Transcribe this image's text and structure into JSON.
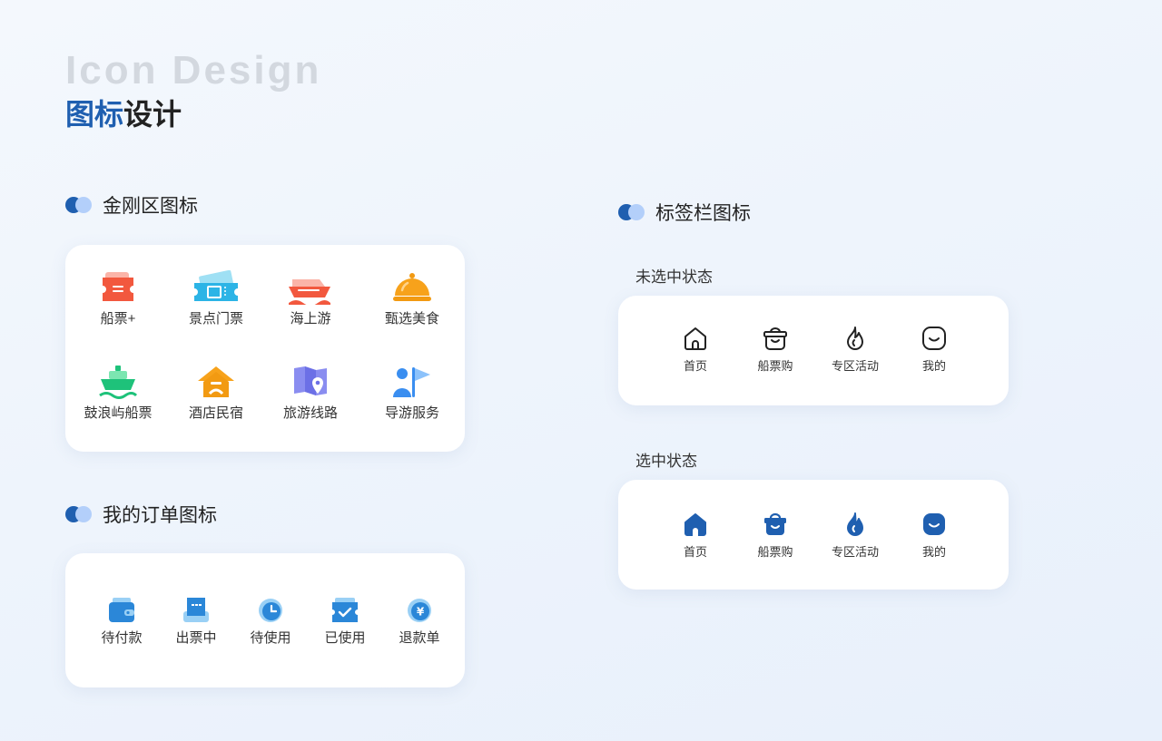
{
  "header": {
    "title_en": "Icon Design",
    "title_cn_accent": "图标",
    "title_cn_rest": "设计"
  },
  "colors": {
    "accent": "#1f5fb0",
    "accent_light": "#b3cffa",
    "card_bg": "#ffffff"
  },
  "kingkong": {
    "section_title": "金刚区图标",
    "items": [
      {
        "label": "船票+",
        "icon": "ticket-icon"
      },
      {
        "label": "景点门票",
        "icon": "admission-ticket-icon"
      },
      {
        "label": "海上游",
        "icon": "cruise-ship-icon"
      },
      {
        "label": "甄选美食",
        "icon": "food-cloche-icon"
      },
      {
        "label": "鼓浪屿船票",
        "icon": "ferry-icon"
      },
      {
        "label": "酒店民宿",
        "icon": "hotel-house-icon"
      },
      {
        "label": "旅游线路",
        "icon": "route-map-icon"
      },
      {
        "label": "导游服务",
        "icon": "guide-flag-icon"
      }
    ]
  },
  "orders": {
    "section_title": "我的订单图标",
    "items": [
      {
        "label": "待付款",
        "icon": "wallet-icon"
      },
      {
        "label": "出票中",
        "icon": "printing-ticket-icon"
      },
      {
        "label": "待使用",
        "icon": "clock-icon"
      },
      {
        "label": "已使用",
        "icon": "checked-ticket-icon"
      },
      {
        "label": "退款单",
        "icon": "refund-yen-icon"
      }
    ]
  },
  "tabbar": {
    "section_title": "标签栏图标",
    "unselected_label": "未选中状态",
    "selected_label": "选中状态",
    "items": [
      {
        "label": "首页",
        "icon": "home-icon"
      },
      {
        "label": "船票购",
        "icon": "shopping-bag-icon"
      },
      {
        "label": "专区活动",
        "icon": "flame-icon"
      },
      {
        "label": "我的",
        "icon": "smile-face-icon"
      }
    ]
  }
}
